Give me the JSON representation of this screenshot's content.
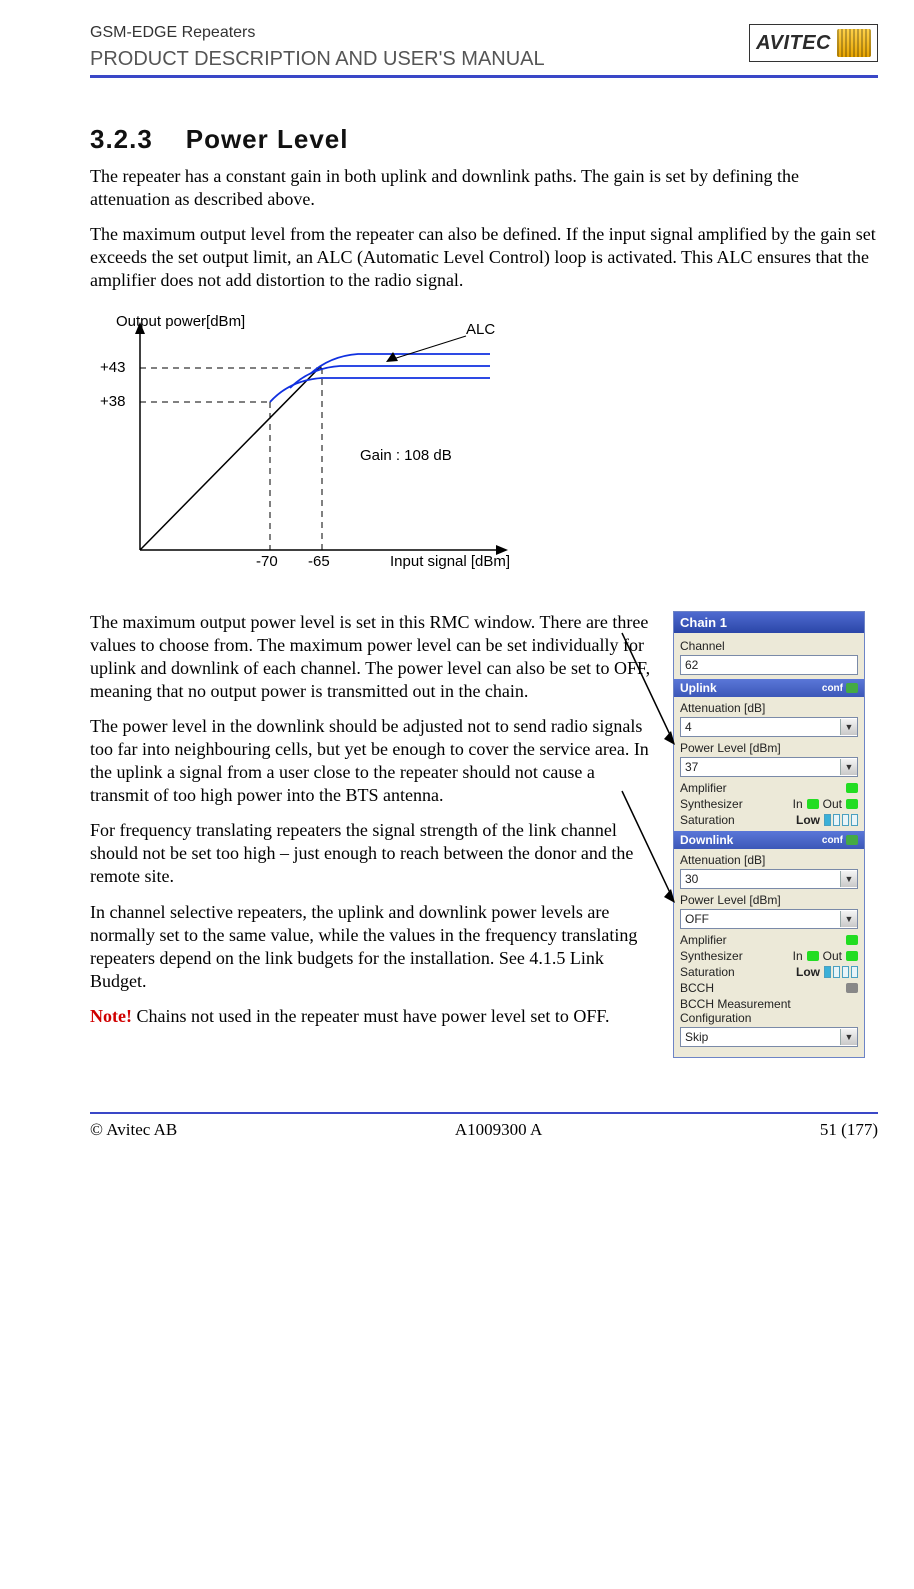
{
  "header": {
    "line1": "GSM-EDGE Repeaters",
    "line2": "PRODUCT DESCRIPTION AND USER'S MANUAL",
    "logo_text": "AVITEC"
  },
  "section": {
    "num": "3.2.3",
    "title": "Power Level"
  },
  "paras": {
    "p1": "The repeater has a constant gain in both uplink and downlink paths. The gain is set by defining the attenuation as described above.",
    "p2": "The maximum output level from the repeater can also be defined. If the input signal amplified by the gain set exceeds the set output limit, an ALC (Automatic Level Control) loop is activated. This ALC ensures that the amplifier does not add distortion to the radio signal.",
    "p3": "The maximum output power level is set in this RMC window. There are three values to choose from. The maximum power level can be set individually for uplink and downlink of each channel. The power level can also be set to OFF, meaning that no output power is transmitted out in the chain.",
    "p4": "The power level in the downlink should be adjusted not to send radio signals too far into neighbouring cells, but yet be enough to cover the service area. In the uplink a signal from a user close to the repeater should not cause a transmit of too high power into the BTS antenna.",
    "p5": "For frequency translating repeaters the signal strength of the link channel should not be set too high – just enough to reach between the donor and the remote site.",
    "p6": "In channel selective repeaters, the uplink and downlink power levels are normally set to the same value, while the values in the frequency translating repeaters depend on the link budgets for the installation. See 4.1.5 Link Budget.",
    "note_label": "Note!",
    "note_text": " Chains not used in the repeater must have power level set to OFF."
  },
  "chart_data": {
    "type": "line",
    "title": "",
    "xlabel": "Input signal [dBm]",
    "ylabel": "Output power[dBm]",
    "gain_label": "Gain : 108 dB",
    "alc_label": "ALC",
    "y_ticks": [
      "+43",
      "+38"
    ],
    "x_ticks": [
      "-70",
      "-65"
    ],
    "series": [
      {
        "name": "linear-region",
        "description": "straight line slope ≈1 (gain 108 dB) up to ALC knee"
      },
      {
        "name": "alc-limit-high",
        "knee_x": -65,
        "limit_y": 43
      },
      {
        "name": "alc-limit-low",
        "knee_x": -70,
        "limit_y": 38
      }
    ],
    "xlim": [
      -100,
      -40
    ],
    "ylim": [
      0,
      45
    ]
  },
  "panel": {
    "title": "Chain 1",
    "channel_label": "Channel",
    "channel_value": "62",
    "uplink": {
      "title": "Uplink",
      "conf": "conf",
      "atten_label": "Attenuation [dB]",
      "atten_value": "4",
      "power_label": "Power Level [dBm]",
      "power_value": "37",
      "amplifier": "Amplifier",
      "synth": "Synthesizer",
      "in": "In",
      "out": "Out",
      "sat": "Saturation",
      "sat_val": "Low"
    },
    "downlink": {
      "title": "Downlink",
      "conf": "conf",
      "atten_label": "Attenuation [dB]",
      "atten_value": "30",
      "power_label": "Power Level [dBm]",
      "power_value": "OFF",
      "amplifier": "Amplifier",
      "synth": "Synthesizer",
      "in": "In",
      "out": "Out",
      "sat": "Saturation",
      "sat_val": "Low",
      "bcch": "BCCH",
      "bcch_meas": "BCCH Measurement Configuration",
      "bcch_val": "Skip"
    }
  },
  "footer": {
    "left": "© Avitec AB",
    "center": "A1009300 A",
    "right": "51 (177)"
  }
}
